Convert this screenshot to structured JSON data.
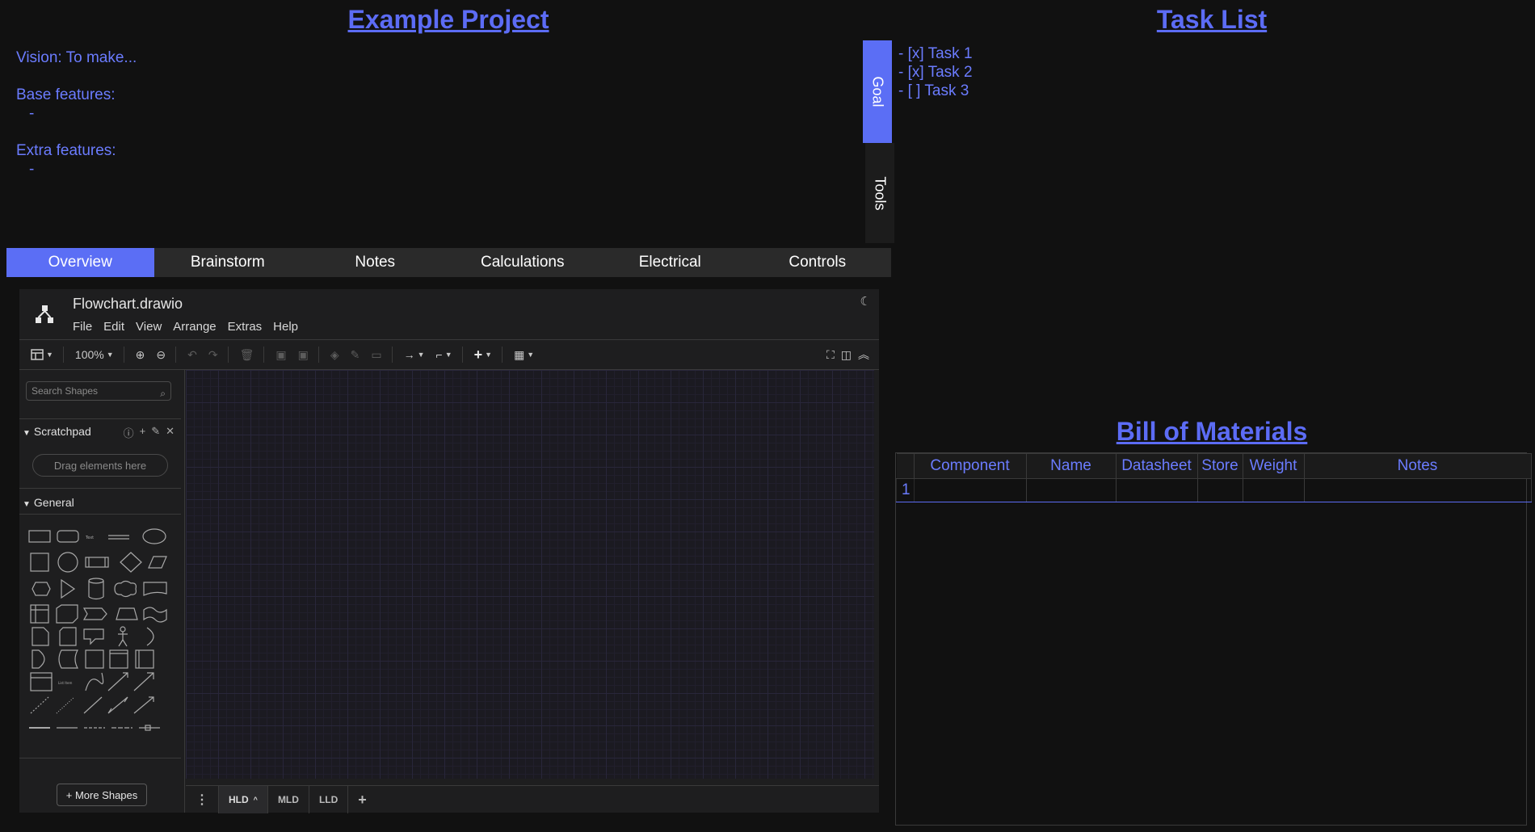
{
  "project": {
    "title": "Example Project",
    "vision": "Vision: To make...",
    "base_label": "Base features:",
    "base_item": "-",
    "extra_label": "Extra features:",
    "extra_item": "-"
  },
  "side_tabs": {
    "goal": "Goal",
    "tools": "Tools"
  },
  "task_list": {
    "title": "Task List",
    "items": [
      "- [x] Task 1",
      "- [x] Task 2",
      "- [ ] Task 3"
    ]
  },
  "tabs": [
    "Overview",
    "Brainstorm",
    "Notes",
    "Calculations",
    "Electrical",
    "Controls"
  ],
  "drawio": {
    "file_name": "Flowchart.drawio",
    "menu": [
      "File",
      "Edit",
      "View",
      "Arrange",
      "Extras",
      "Help"
    ],
    "zoom": "100%",
    "search_placeholder": "Search Shapes",
    "scratchpad_label": "Scratchpad",
    "drag_hint": "Drag elements here",
    "general_label": "General",
    "more_shapes": "+ More Shapes",
    "pages": [
      "HLD",
      "MLD",
      "LLD"
    ]
  },
  "bom": {
    "title": "Bill of Materials",
    "columns": [
      "Component",
      "Name",
      "Datasheet",
      "Store",
      "Weight",
      "Notes"
    ],
    "row_number": "1"
  },
  "colors": {
    "accent": "#5b6ef5",
    "text_accent": "#6b7cff",
    "background": "#111111"
  }
}
